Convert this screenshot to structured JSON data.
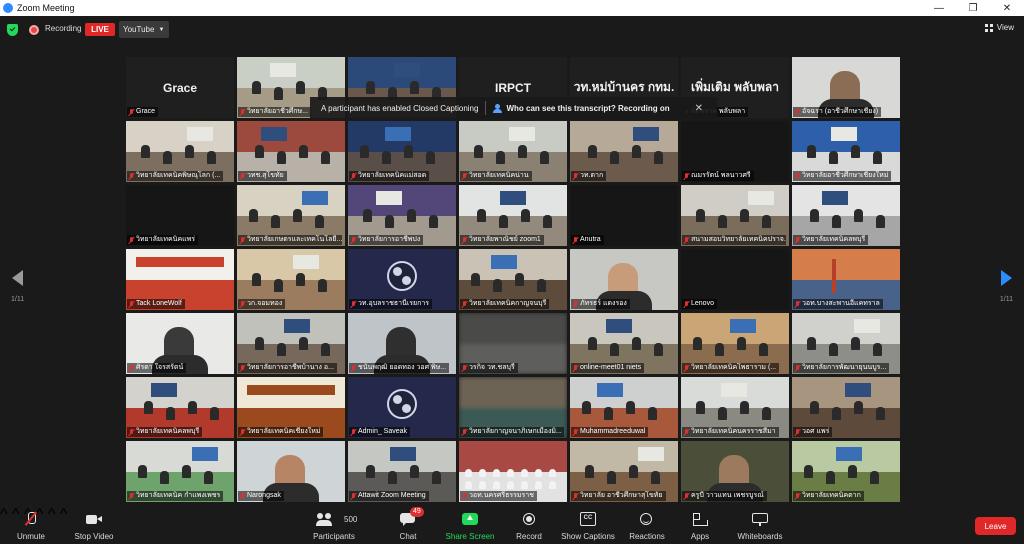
{
  "window": {
    "title": "Zoom Meeting",
    "controls": [
      "—",
      "❐",
      "✕"
    ]
  },
  "top": {
    "recording_label": "Recording",
    "live_badge": "LIVE",
    "stream_target": "YouTube",
    "view_label": "View"
  },
  "notice": {
    "text": "A participant has enabled Closed Captioning",
    "link": "Who can see this transcript? Recording on",
    "close": "✕"
  },
  "pager": {
    "left_label": "1/11",
    "right_label": "1/11"
  },
  "tiles": [
    {
      "name": "Grace",
      "kind": "name",
      "big": "Grace"
    },
    {
      "name": "วิทยาลัยอาชีวศึกษ...",
      "kind": "room",
      "wall": "#c9cfc5",
      "floor": "#a69b86"
    },
    {
      "name": "",
      "kind": "room",
      "wall": "#2b4a7a",
      "floor": "#69584b"
    },
    {
      "name": "",
      "kind": "name",
      "big": "IRPCT"
    },
    {
      "name": "",
      "kind": "name",
      "big": "วท.หม่บ้านคร กทม."
    },
    {
      "name": "ผิดพลาด พลับพลา",
      "kind": "name",
      "big": "เพิ่มเติม พลับพลา"
    },
    {
      "name": "อัจฉรา (อาชีวศึกษาเชียง)",
      "kind": "face",
      "wall": "#d8d8d6",
      "skin": "#8b6d55"
    },
    {
      "name": "วิทยาลัยเทคนิคพิษณุโลก (...",
      "kind": "room",
      "wall": "#d7d2c5",
      "floor": "#7d6f5f"
    },
    {
      "name": "วทช.สุโขทัย",
      "kind": "room",
      "wall": "#9c4a3e",
      "floor": "#b7b1a8"
    },
    {
      "name": "วิทยาลัยเทคนิคแม่สอด",
      "kind": "room",
      "wall": "#233a66",
      "floor": "#5a4e48"
    },
    {
      "name": "วิทยาลัยเทคนิคน่าน",
      "kind": "room",
      "wall": "#c8cac4",
      "floor": "#8b8173"
    },
    {
      "name": "วท.ตาก",
      "kind": "room",
      "wall": "#b6a998",
      "floor": "#6c5a4c"
    },
    {
      "name": "ณมรรัตน์ พลนาวศรี",
      "kind": "dark"
    },
    {
      "name": "วิทยาลัยอาชีวศึกษาเชียงใหม่",
      "kind": "room",
      "wall": "#2d5faa",
      "floor": "#d9d9d9"
    },
    {
      "name": "วิทยาลัยเทคนิคแพร่",
      "kind": "dark"
    },
    {
      "name": "วิทยาลัยเกษตรและเทคโนโลยี...",
      "kind": "room",
      "wall": "#d8d2c2",
      "floor": "#8a7a66"
    },
    {
      "name": "วิทยาลัยการอาชีพปง",
      "kind": "room",
      "wall": "#53477a",
      "floor": "#a39a8f"
    },
    {
      "name": "วิทยาลัยพาณิชย์ zoom1",
      "kind": "room",
      "wall": "#e2e4e3",
      "floor": "#93897c"
    },
    {
      "name": "Anutra",
      "kind": "dark"
    },
    {
      "name": "สนามสอบวิทยาลัยเทคนิคปราจ...",
      "kind": "room",
      "wall": "#cfcdc6",
      "floor": "#7a6d5b"
    },
    {
      "name": "วิทยาลัยเทคนิคลพบุรี",
      "kind": "room",
      "wall": "#e4e4e4",
      "floor": "#a6a6a6"
    },
    {
      "name": "Tack LoneWolf",
      "kind": "slide",
      "wall": "#f2f0ea",
      "floor": "#c8422e"
    },
    {
      "name": "วก.จอมทอง",
      "kind": "room",
      "wall": "#d9c8a8",
      "floor": "#9b7c5f"
    },
    {
      "name": "วท.อุบลราชธานีเรยการ",
      "kind": "obs"
    },
    {
      "name": "วิทยาลัยเทคนิคกาญจนบุรี",
      "kind": "room",
      "wall": "#c9c2b5",
      "floor": "#5d4b3c"
    },
    {
      "name": "ภัทรธร์ แดงรอง",
      "kind": "face",
      "wall": "#c7c7c3",
      "skin": "#c69c7b"
    },
    {
      "name": "Lenovo",
      "kind": "dark"
    },
    {
      "name": "วอท.บางสะพานอีแคทราล",
      "kind": "scenic",
      "wall": "#d57d4b",
      "floor": "#48628a"
    },
    {
      "name": "ศิรดา ใจรสรัตน์",
      "kind": "face",
      "wall": "#e9e9e7",
      "skin": "#3a3a3a"
    },
    {
      "name": "วิทยาลัยการอาชีพบ้านาง อ...",
      "kind": "room",
      "wall": "#bfc1ba",
      "floor": "#76685a"
    },
    {
      "name": "ชนันพฤฒิ ยอดทอง วอศ พิษ...",
      "kind": "face",
      "wall": "#bfc4c9",
      "skin": "#2f2f2f"
    },
    {
      "name": "วรกิจ วท.ชลบุรี",
      "kind": "blur",
      "wall": "#4a4a48",
      "floor": "#5e5e5c"
    },
    {
      "name": "online-meet01 niets",
      "kind": "room",
      "wall": "#c8c6bd",
      "floor": "#7e7460",
      "active": true
    },
    {
      "name": "วิทยาลัยเทคนิคโพธาราม (...",
      "kind": "room",
      "wall": "#caa575",
      "floor": "#8b6c4e"
    },
    {
      "name": "วิทยาลัยการพัฒนายุนนบูร...",
      "kind": "room",
      "wall": "#d0d0cc",
      "floor": "#8e8e88"
    },
    {
      "name": "วิทยาลัยเทคนิคลพบุรี",
      "kind": "room",
      "wall": "#d4d2cc",
      "floor": "#b23a2d"
    },
    {
      "name": "วิทยาลัยเทคนิคเชียงใหม่",
      "kind": "banner",
      "wall": "#efe8d6",
      "floor": "#9a4a1d"
    },
    {
      "name": "Admin_ Saveak",
      "kind": "obs"
    },
    {
      "name": "วิทยาลัยกาญจนาภิเษกเมืองมิ...",
      "kind": "blur",
      "wall": "#6d6354",
      "floor": "#3c5a55"
    },
    {
      "name": "Muhammadreeduwal",
      "kind": "room",
      "wall": "#cdd0cf",
      "floor": "#a8593b"
    },
    {
      "name": "วิทยาลัยเทคนิคนครราชสีมา",
      "kind": "room",
      "wall": "#d9dbd8",
      "floor": "#8b8a82"
    },
    {
      "name": "วอศ แพร่",
      "kind": "room",
      "wall": "#a89580",
      "floor": "#5d4a3a"
    },
    {
      "name": "วิทยาลัยเทคนิค กำแพงเพชร",
      "kind": "room",
      "wall": "#d8dad6",
      "floor": "#6ea36c"
    },
    {
      "name": "Narongsak",
      "kind": "face",
      "wall": "#cfd4d6",
      "skin": "#b68566"
    },
    {
      "name": "Attawit Zoom Meeting",
      "kind": "room",
      "wall": "#c5c7c2",
      "floor": "#5c5a57"
    },
    {
      "name": "วอท.นครศรีธรรมราช",
      "kind": "crowd",
      "wall": "#a84a43",
      "floor": "#e2e2e2"
    },
    {
      "name": "วิทยาลัย อาชีวศึกษาสุโขทัย",
      "kind": "room",
      "wall": "#c2b8a6",
      "floor": "#7d5f45"
    },
    {
      "name": "ครูบี วาวแทน เพชรบูรณ์",
      "kind": "face",
      "wall": "#4b4f3a",
      "skin": "#9c7a5e"
    },
    {
      "name": "วิทยาลัยเทคนิคตาก",
      "kind": "room",
      "wall": "#b9c9a2",
      "floor": "#6a7d45"
    }
  ],
  "toolbar": {
    "unmute": "Unmute",
    "stop_video": "Stop Video",
    "participants": "Participants",
    "participants_count": "500",
    "chat": "Chat",
    "chat_badge": "49",
    "share_screen": "Share Screen",
    "record": "Record",
    "show_captions": "Show Captions",
    "reactions": "Reactions",
    "apps": "Apps",
    "whiteboards": "Whiteboards",
    "leave": "Leave"
  },
  "colors": {
    "accent_blue": "#2d8cff",
    "share_green": "#23d959",
    "leave_red": "#e02828",
    "active_outline": "#f0d83a"
  }
}
